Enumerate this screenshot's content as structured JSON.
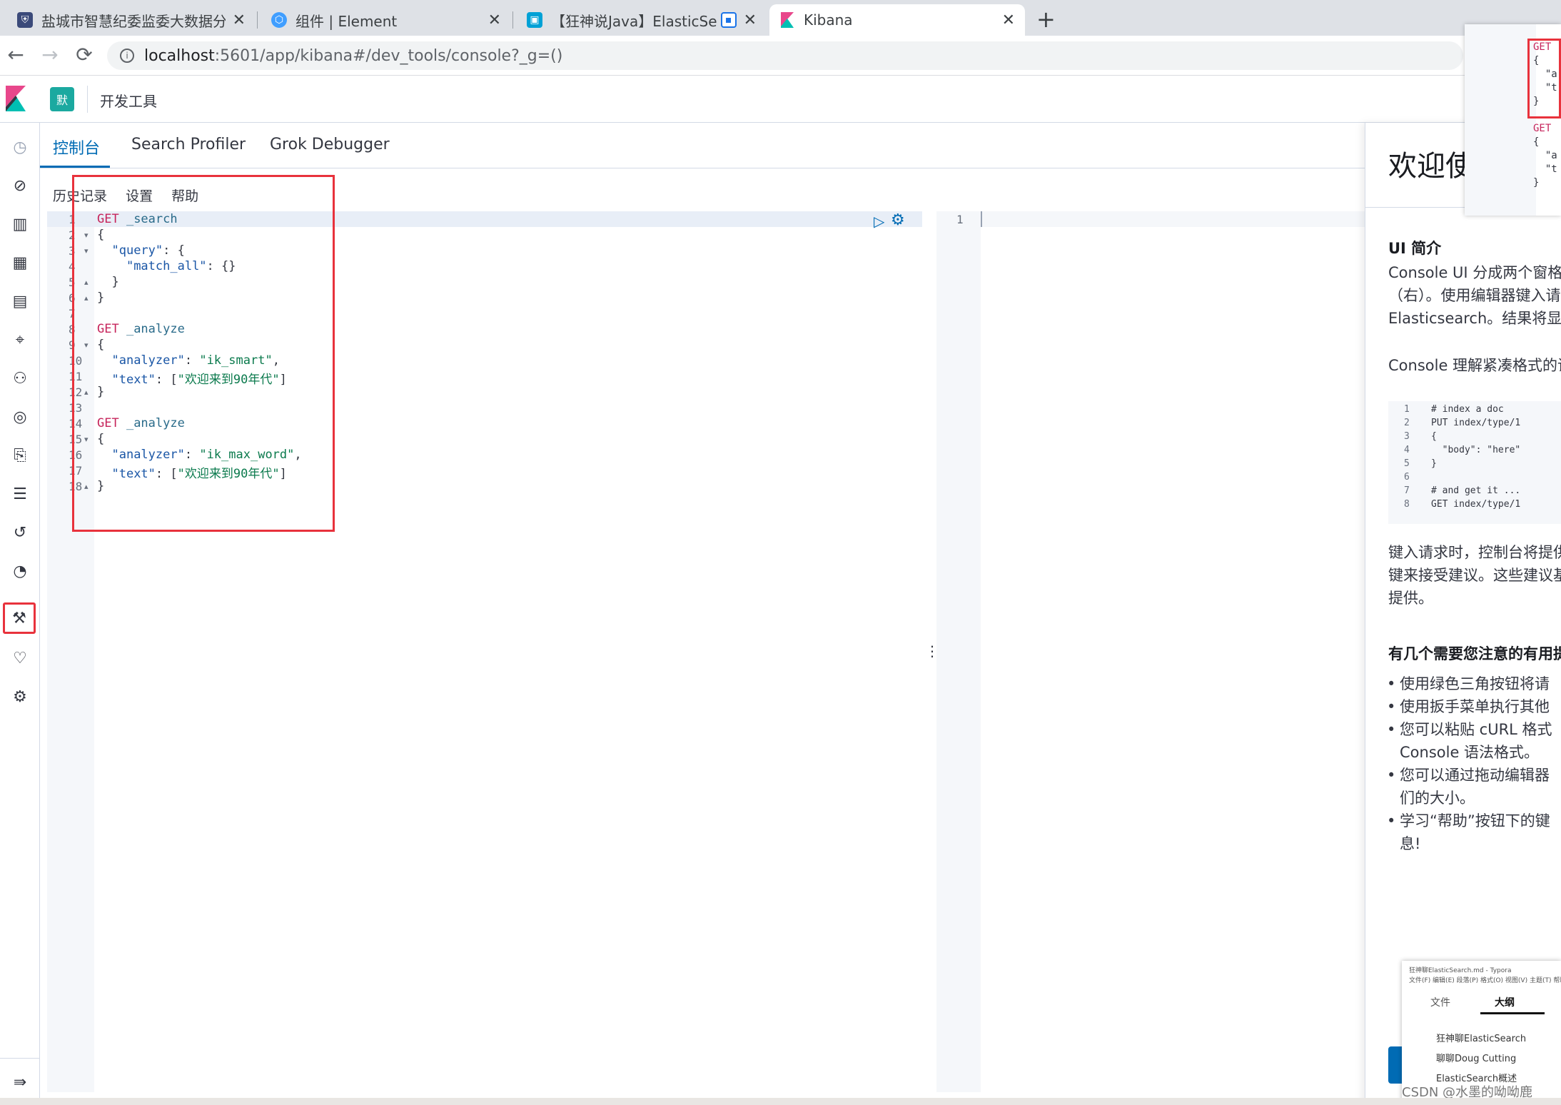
{
  "browser": {
    "tabs": [
      {
        "title": "盐城市智慧纪委监委大数据分析平",
        "close": "✕"
      },
      {
        "title": "组件 | Element",
        "close": "✕"
      },
      {
        "title": "【狂神说Java】ElasticSearc",
        "close": "✕"
      },
      {
        "title": "Kibana",
        "close": "✕"
      }
    ],
    "new_tab": "+",
    "url_host": "localhost",
    "url_rest": ":5601/app/kibana#/dev_tools/console?_g=()",
    "nav": {
      "back": "←",
      "forward": "→",
      "reload": "⟳"
    }
  },
  "kibana": {
    "space_badge": "默",
    "breadcrumb": "开发工具",
    "tabs": [
      "控制台",
      "Search Profiler",
      "Grok Debugger"
    ],
    "toolbar": [
      "历史记录",
      "设置",
      "帮助"
    ]
  },
  "nav_icons": [
    {
      "name": "recent-icon",
      "glyph": "◷"
    },
    {
      "name": "discover-icon",
      "glyph": "⊘"
    },
    {
      "name": "visualize-icon",
      "glyph": "▥"
    },
    {
      "name": "dashboard-icon",
      "glyph": "▦"
    },
    {
      "name": "canvas-icon",
      "glyph": "▤"
    },
    {
      "name": "maps-icon",
      "glyph": "⌖"
    },
    {
      "name": "ml-icon",
      "glyph": "⚇"
    },
    {
      "name": "infra-icon",
      "glyph": "◎"
    },
    {
      "name": "logs-icon",
      "glyph": "⎘"
    },
    {
      "name": "apm-icon",
      "glyph": "☰"
    },
    {
      "name": "uptime-icon",
      "glyph": "↺"
    },
    {
      "name": "siem-icon",
      "glyph": "◔"
    },
    {
      "name": "devtools-icon",
      "glyph": "⚒"
    },
    {
      "name": "monitoring-icon",
      "glyph": "♡"
    },
    {
      "name": "management-icon",
      "glyph": "⚙"
    }
  ],
  "collapse_icon": "⇛",
  "editor": {
    "lines": [
      [
        {
          "t": "GET ",
          "c": "kw"
        },
        {
          "t": "_search",
          "c": "ep"
        }
      ],
      [
        {
          "t": "{",
          "c": ""
        }
      ],
      [
        {
          "t": "  ",
          "c": ""
        },
        {
          "t": "\"query\"",
          "c": "prop"
        },
        {
          "t": ": {",
          "c": ""
        }
      ],
      [
        {
          "t": "    ",
          "c": ""
        },
        {
          "t": "\"match_all\"",
          "c": "prop"
        },
        {
          "t": ": {}",
          "c": ""
        }
      ],
      [
        {
          "t": "  }",
          "c": ""
        }
      ],
      [
        {
          "t": "}",
          "c": ""
        }
      ],
      [
        {
          "t": "",
          "c": ""
        }
      ],
      [
        {
          "t": "GET ",
          "c": "kw"
        },
        {
          "t": "_analyze",
          "c": "ep"
        }
      ],
      [
        {
          "t": "{",
          "c": ""
        }
      ],
      [
        {
          "t": "  ",
          "c": ""
        },
        {
          "t": "\"analyzer\"",
          "c": "prop"
        },
        {
          "t": ": ",
          "c": ""
        },
        {
          "t": "\"ik_smart\"",
          "c": "str"
        },
        {
          "t": ",",
          "c": ""
        }
      ],
      [
        {
          "t": "  ",
          "c": ""
        },
        {
          "t": "\"text\"",
          "c": "prop"
        },
        {
          "t": ": [",
          "c": ""
        },
        {
          "t": "\"欢迎来到90年代\"",
          "c": "str"
        },
        {
          "t": "]",
          "c": ""
        }
      ],
      [
        {
          "t": "}",
          "c": ""
        }
      ],
      [
        {
          "t": "",
          "c": ""
        }
      ],
      [
        {
          "t": "GET ",
          "c": "kw"
        },
        {
          "t": "_analyze",
          "c": "ep"
        }
      ],
      [
        {
          "t": "{",
          "c": ""
        }
      ],
      [
        {
          "t": "  ",
          "c": ""
        },
        {
          "t": "\"analyzer\"",
          "c": "prop"
        },
        {
          "t": ": ",
          "c": ""
        },
        {
          "t": "\"ik_max_word\"",
          "c": "str"
        },
        {
          "t": ",",
          "c": ""
        }
      ],
      [
        {
          "t": "  ",
          "c": ""
        },
        {
          "t": "\"text\"",
          "c": "prop"
        },
        {
          "t": ": [",
          "c": ""
        },
        {
          "t": "\"欢迎来到90年代\"",
          "c": "str"
        },
        {
          "t": "]",
          "c": ""
        }
      ],
      [
        {
          "t": "}",
          "c": ""
        }
      ]
    ],
    "fold_markers": {
      "2": "▾",
      "3": "▾",
      "5": "▴",
      "6": "▴",
      "9": "▾",
      "12": "▴",
      "15": "▾",
      "18": "▴"
    },
    "run_icon": "▷",
    "wrench_icon": "⚙"
  },
  "output": {
    "line": "1"
  },
  "splitter": "⋮",
  "flyout": {
    "title": "欢迎使",
    "section1": "UI 简介",
    "p1": [
      "Console UI 分成两个窗格",
      "（右）。使用编辑器键入请",
      "Elasticsearch。结果将显"
    ],
    "p2": "Console 理解紧凑格式的请",
    "code": [
      {
        "n": "1",
        "t": "# index a doc"
      },
      {
        "n": "2",
        "t": "PUT index/type/1"
      },
      {
        "n": "3",
        "t": "{"
      },
      {
        "n": "4",
        "t": "  \"body\": \"here\""
      },
      {
        "n": "5",
        "t": "}"
      },
      {
        "n": "6",
        "t": ""
      },
      {
        "n": "7",
        "t": "# and get it ..."
      },
      {
        "n": "8",
        "t": "GET index/type/1"
      }
    ],
    "p3": [
      "键入请求时，控制台将提供",
      "键来接受建议。这些建议基",
      "提供。"
    ],
    "section2": "有几个需要您注意的有用提",
    "bullets": [
      "使用绿色三角按钮将请",
      "使用扳手菜单执行其他",
      "您可以粘贴 cURL 格式",
      "Console 语法格式。",
      "您可以通过拖动编辑器",
      "们的大小。",
      "学习“帮助”按钮下的键",
      "息!"
    ]
  },
  "overlay_top": {
    "lines": [
      "GET",
      "{",
      "  \"a",
      "  \"t",
      "}",
      "",
      "GET",
      "{",
      "  \"a",
      "  \"t",
      "}"
    ]
  },
  "overlay_bottom": {
    "title": "狂神聊ElasticSearch.md - Typora",
    "menu": "文件(F) 编辑(E) 段落(P) 格式(O) 视图(V) 主题(T) 帮助(H)",
    "tabs": [
      "文件",
      "大纲"
    ],
    "items": [
      "狂神聊ElasticSearch",
      "聊聊Doug Cutting",
      "ElasticSearch概述"
    ]
  },
  "watermark": "CSDN @水墨的呦呦鹿"
}
